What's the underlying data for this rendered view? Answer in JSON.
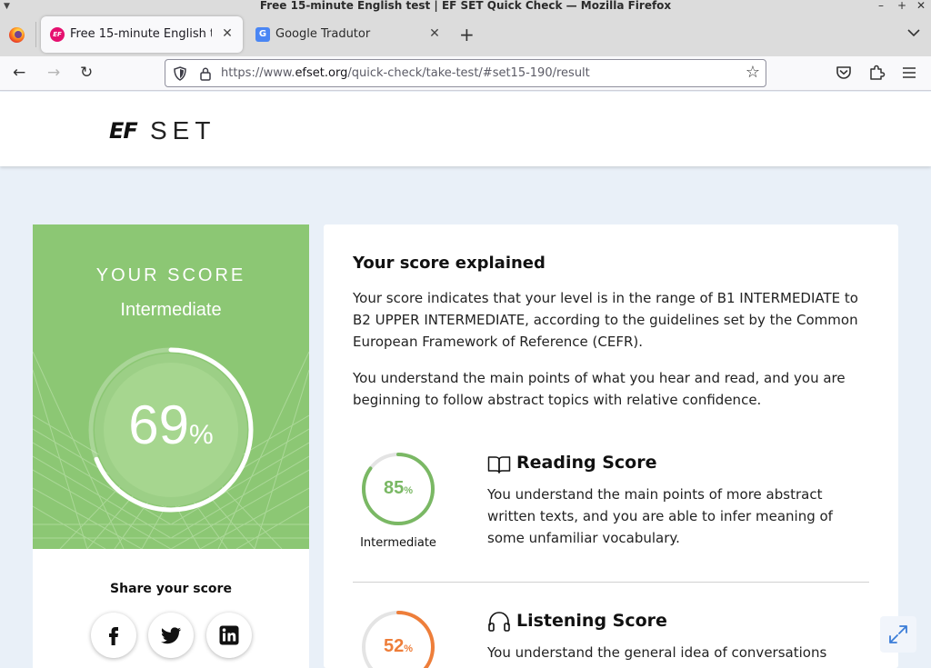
{
  "window": {
    "title": "Free 15-minute English test | EF SET Quick Check — Mozilla Firefox",
    "minimize": "–",
    "maximize": "+",
    "close": "✕"
  },
  "tabs": [
    {
      "label": "Free 15-minute English test | EF SET Quick Check",
      "favicon_text": "EF",
      "close": "✕",
      "active": true
    },
    {
      "label": "Google Tradutor",
      "favicon_text": "G",
      "close": "✕",
      "active": false
    }
  ],
  "toolbar": {
    "new_tab": "+",
    "tab_list": "⌄",
    "back": "←",
    "forward": "→",
    "reload": "↻",
    "bookmark": "☆"
  },
  "url": {
    "prefix": "https://www.",
    "domain": "efset.org",
    "path": "/quick-check/take-test/#set15-190/result"
  },
  "site": {
    "logo_ef": "EF",
    "logo_set": "SET"
  },
  "score": {
    "label": "YOUR SCORE",
    "level": "Intermediate",
    "value": "69",
    "percent_symbol": "%",
    "fraction": 0.69,
    "share_title": "Share your score"
  },
  "explanation": {
    "title": "Your score explained",
    "para1": "Your score indicates that your level is in the range of B1 INTERMEDIATE to B2 UPPER INTERMEDIATE, according to the guidelines set by the Common European Framework of Reference (CEFR).",
    "para2": "You understand the main points of what you hear and read, and you are beginning to follow abstract topics with relative confidence."
  },
  "reading": {
    "title": "Reading Score",
    "value": "85",
    "percent_symbol": "%",
    "fraction": 0.85,
    "level": "Intermediate",
    "description": "You understand the main points of more abstract written texts, and you are able to infer meaning of some unfamiliar vocabulary.",
    "color": "#7ab864"
  },
  "listening": {
    "title": "Listening Score",
    "value": "52",
    "percent_symbol": "%",
    "fraction": 0.52,
    "description": "You understand the general idea of conversations relevant to",
    "color": "#ee7e3a"
  },
  "colors": {
    "score_green": "#8cc774",
    "page_bg": "#e9f0f8"
  }
}
